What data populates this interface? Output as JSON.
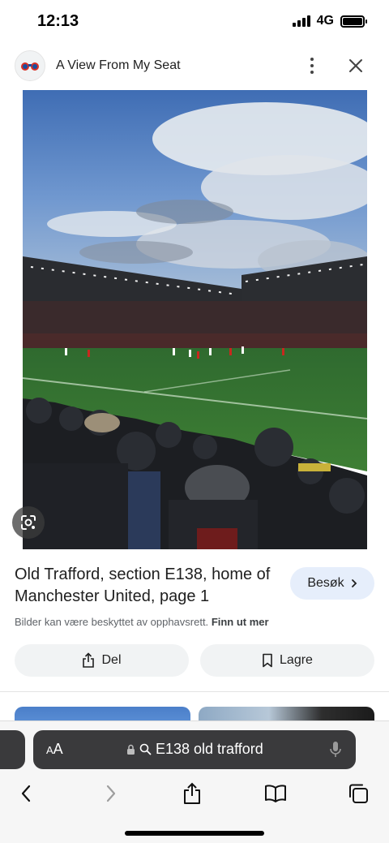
{
  "status_bar": {
    "time": "12:13",
    "network": "4G"
  },
  "site_header": {
    "title": "A View From My Seat",
    "logo_icon": "binoculars-icon",
    "menu_icon": "more-vert-icon",
    "close_icon": "close-icon"
  },
  "image": {
    "lens_icon": "google-lens-icon"
  },
  "result": {
    "title": "Old Trafford, section E138, home of Manchester United, page 1",
    "visit_label": "Besøk",
    "copyright_text": "Bilder kan være beskyttet av opphavsrett.",
    "learn_more": "Finn ut mer"
  },
  "actions": {
    "share_label": "Del",
    "save_label": "Lagre"
  },
  "browser": {
    "aa_small": "A",
    "aa_large": "A",
    "url_text": "E138 old trafford",
    "accent": "#3a3a3c"
  },
  "colors": {
    "visit_bg": "#e6eefb",
    "action_bg": "#f1f3f4"
  }
}
